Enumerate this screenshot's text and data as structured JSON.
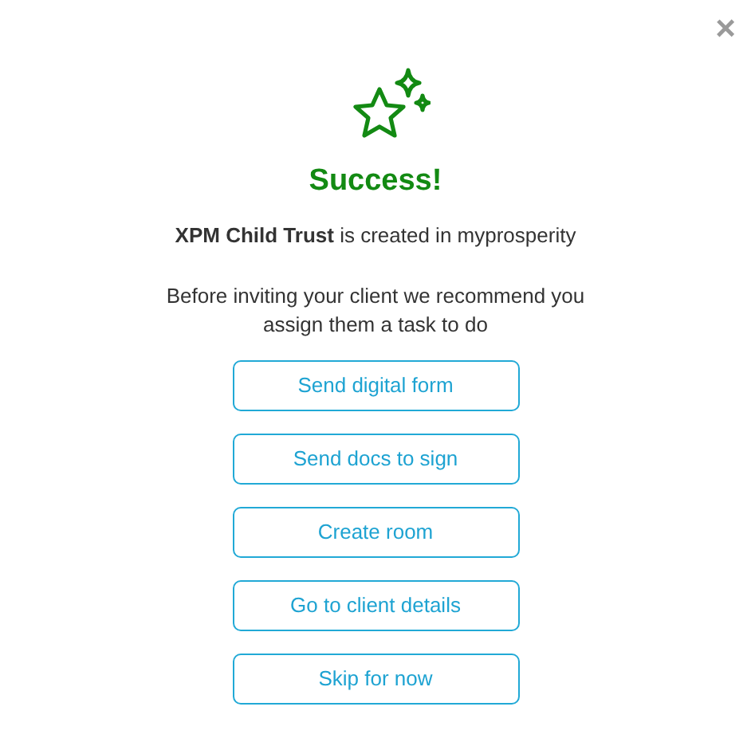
{
  "dialog": {
    "close": "×",
    "title": "Success!",
    "message": "**XPM Child Trust** is created in myprosperity",
    "recommendation": "Before inviting your client we recommend you assign them a task to do",
    "buttons": [
      "Send digital form",
      "Send docs to sign",
      "Create room",
      "Go to client details",
      "Skip for now"
    ]
  }
}
